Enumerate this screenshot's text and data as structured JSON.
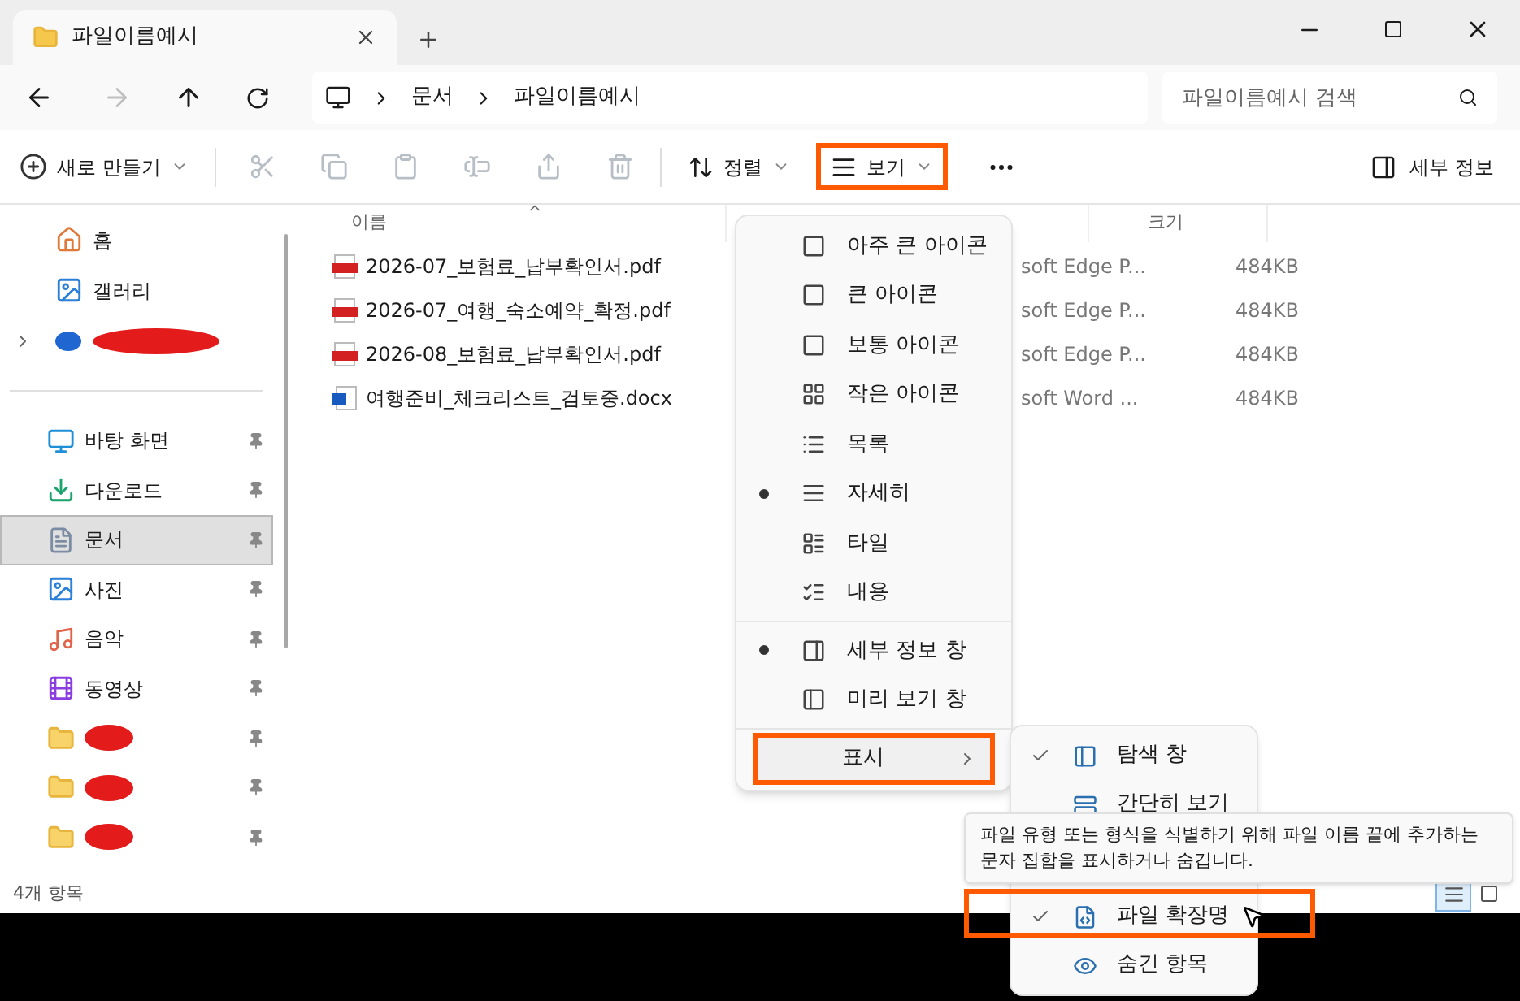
{
  "tabs": [
    {
      "title": "파일이름예시",
      "selected": true
    }
  ],
  "nav": {
    "breadcrumbs": [
      "문서",
      "파일이름예시"
    ],
    "search": {
      "placeholder": "파일이름예시 검색"
    }
  },
  "toolbar": {
    "new": "새로 만들기",
    "sort": "정렬",
    "view": {
      "label": "보기",
      "highlighted": true
    },
    "details": "세부 정보"
  },
  "sidebar": {
    "top": [
      {
        "label": "홈",
        "redacted": false,
        "expandable": false
      },
      {
        "label": "갤러리",
        "redacted": false,
        "expandable": false
      },
      {
        "redacted": true,
        "expandable": true
      }
    ],
    "pinned": [
      {
        "label": "바탕 화면",
        "redacted": false,
        "selected": false
      },
      {
        "label": "다운로드",
        "redacted": false,
        "selected": false
      },
      {
        "label": "문서",
        "redacted": false,
        "selected": true
      },
      {
        "label": "사진",
        "redacted": false,
        "selected": false
      },
      {
        "label": "음악",
        "redacted": false,
        "selected": false
      },
      {
        "label": "동영상",
        "redacted": false,
        "selected": false
      },
      {
        "redacted": true,
        "selected": false
      },
      {
        "redacted": true,
        "selected": false
      },
      {
        "redacted": true,
        "selected": false
      }
    ]
  },
  "table": {
    "columns": [
      {
        "label": "이름",
        "sorted": true
      },
      {
        "label": "크기",
        "sorted": false
      }
    ],
    "rows": [
      {
        "kind": "pdf",
        "name": "2026-07_보험료_납부확인서.pdf",
        "type": "soft Edge P...",
        "size": "484KB"
      },
      {
        "kind": "pdf",
        "name": "2026-07_여행_숙소예약_확정.pdf",
        "type": "soft Edge P...",
        "size": "484KB"
      },
      {
        "kind": "pdf",
        "name": "2026-08_보험료_납부확인서.pdf",
        "type": "soft Edge P...",
        "size": "484KB"
      },
      {
        "kind": "docx",
        "name": "여행준비_체크리스트_검토중.docx",
        "type": "soft Word ...",
        "size": "484KB"
      }
    ]
  },
  "view_menu": {
    "items": [
      {
        "kind": "option",
        "label": "아주 큰 아이콘",
        "selected": false
      },
      {
        "kind": "option",
        "label": "큰 아이콘",
        "selected": false
      },
      {
        "kind": "option",
        "label": "보통 아이콘",
        "selected": false
      },
      {
        "kind": "option",
        "label": "작은 아이콘",
        "selected": false
      },
      {
        "kind": "option",
        "label": "목록",
        "selected": false
      },
      {
        "kind": "option",
        "label": "자세히",
        "selected": true
      },
      {
        "kind": "option",
        "label": "타일",
        "selected": false
      },
      {
        "kind": "option",
        "label": "내용",
        "selected": false
      },
      {
        "kind": "separator"
      },
      {
        "kind": "option",
        "label": "세부 정보 창",
        "selected": true
      },
      {
        "kind": "option",
        "label": "미리 보기 창",
        "selected": false
      },
      {
        "kind": "separator"
      },
      {
        "kind": "submenu",
        "label": "표시",
        "highlighted": true
      }
    ]
  },
  "show_menu": {
    "items": [
      {
        "label": "탐색 창",
        "checked": true,
        "highlighted": false
      },
      {
        "label": "간단히 보기",
        "checked": false,
        "highlighted": false
      },
      {
        "label": "파일 확장명",
        "checked": true,
        "highlighted": true
      },
      {
        "label": "숨긴 항목",
        "checked": false,
        "highlighted": false
      }
    ]
  },
  "tooltip": "파일 유형 또는 형식을 식별하기 위해 파일 이름 끝에 추가하는 문자 집합을 표시하거나 숨깁니다.",
  "status_bar": {
    "count": "4개 항목",
    "view_toggles": [
      {
        "selected": true
      },
      {
        "selected": false
      }
    ]
  }
}
